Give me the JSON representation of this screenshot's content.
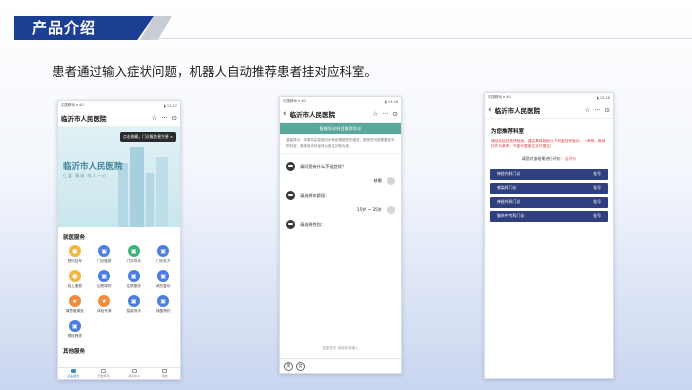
{
  "slide": {
    "title": "产品介绍",
    "subtitle": "患者通过输入症状问题，机器人自动推荐患者挂对应科室。"
  },
  "phone1": {
    "status_left": "中国移动 ▾ 4G",
    "status_right": "▮ 13:27",
    "nav_title": "临沂市人民医院",
    "nav_star": "☆",
    "nav_more": "···",
    "nav_target": "⊙",
    "tooltip": "点击收藏，门诊服务更方便 ×",
    "hero_title": "临沂市人民医院",
    "hero_slogan": "仁爱 精诚  唯人一心",
    "section1": "就医服务",
    "services": [
      {
        "label": "预约挂号",
        "color": "#f4b63f",
        "glyph": "●"
      },
      {
        "label": "门诊缴费",
        "color": "#4a7ee0",
        "glyph": "▣"
      },
      {
        "label": "门诊导诊",
        "color": "#3fb37a",
        "glyph": "▣"
      },
      {
        "label": "门诊处方",
        "color": "#4a7ee0",
        "glyph": "▣"
      },
      {
        "label": "线上缴费",
        "color": "#f4b63f",
        "glyph": "●"
      },
      {
        "label": "出院带药",
        "color": "#4a7ee0",
        "glyph": "▣"
      },
      {
        "label": "住院服务",
        "color": "#4a7ee0",
        "glyph": "▣"
      },
      {
        "label": "病历复印",
        "color": "#4a7ee0",
        "glyph": "▣"
      },
      {
        "label": "满意度调查",
        "color": "#f28b3a",
        "glyph": "★"
      },
      {
        "label": "体检号源",
        "color": "#f28b3a",
        "glyph": "★"
      },
      {
        "label": "智能导诊",
        "color": "#4a7ee0",
        "glyph": "▣"
      },
      {
        "label": "核酸预约",
        "color": "#4a7ee0",
        "glyph": "▣"
      },
      {
        "label": "预检筛查",
        "color": "#4a7ee0",
        "glyph": "▣"
      }
    ],
    "section2": "其他服务",
    "tabs": [
      "就医服务",
      "智能导诊",
      "消息中心",
      "我的"
    ]
  },
  "phone2": {
    "status_left": "中国移动 ▾ 4G",
    "status_right": "▮ 13:28",
    "nav_back": "‹",
    "nav_title": "临沂市人民医院",
    "nav_star": "☆",
    "nav_more": "···",
    "nav_target": "⊙",
    "banner": "智能导诊科目推荐导诊",
    "notice": "温馨提示：本服务由智能问诊系统根据您的描述，推荐您可能需要挂号的科室，具体就诊科室请以医生诊断为准。",
    "q1": "请问您有什么不适症状？",
    "a1": "咳嗽",
    "q2": "请选择年龄段：",
    "a2": "15岁 ~ 35岁",
    "q3": "请选择性别：",
    "footer_hint": "智能导诊  请选择或输入",
    "footer_btn1": "男",
    "footer_btn2": "女"
  },
  "phone3": {
    "status_left": "中国移动 ▾ 4G",
    "status_right": "▮ 13:28",
    "nav_back": "‹",
    "nav_title": "临沂市人民医院",
    "nav_star": "☆",
    "nav_more": "···",
    "nav_target": "⊙",
    "rec_title": "为您推荐科室",
    "rec_warn": "请结合症状选择就医，建议具体就医以下科室挂号就诊。（声明：推荐仅作为参考，不能代替医生诊疗建议）",
    "eval_text": "请您对该结果进行评价：",
    "eval_link": "去评价",
    "depts": [
      {
        "name": "神经内科门诊",
        "action": "挂号"
      },
      {
        "name": "感染科门诊",
        "action": "挂号"
      },
      {
        "name": "神经外科门诊",
        "action": "挂号"
      },
      {
        "name": "脑卒中专科门诊",
        "action": "挂号"
      }
    ]
  }
}
